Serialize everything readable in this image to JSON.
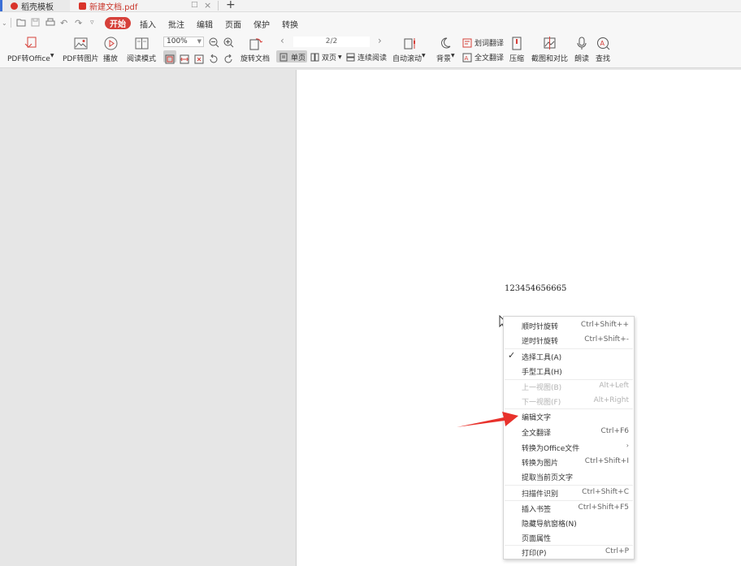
{
  "tabs": [
    {
      "label": "稻壳模板"
    },
    {
      "label": "新建文档.pdf"
    }
  ],
  "menu": {
    "active": "开始",
    "items": [
      "插入",
      "批注",
      "编辑",
      "页面",
      "保护",
      "转换"
    ]
  },
  "ribbon": {
    "pdf_to_office": "PDF转Office",
    "pdf_to_image": "PDF转图片",
    "play": "播放",
    "read_mode": "阅读模式",
    "zoom_value": "100%",
    "rotate_doc": "旋转文档",
    "page_value": "2/2",
    "single_page": "单页",
    "double_page": "双页",
    "continuous": "连续阅读",
    "auto_scroll": "自动滚动",
    "background": "背景",
    "word_translate": "划词翻译",
    "full_translate": "全文翻译",
    "compress": "压缩",
    "screenshot_compare": "截图和对比",
    "read_aloud": "朗读",
    "find": "查找"
  },
  "document": {
    "text": "123454656665"
  },
  "context_menu": {
    "items": [
      {
        "label": "顺时针旋转",
        "shortcut": "Ctrl+Shift++"
      },
      {
        "label": "逆时针旋转",
        "shortcut": "Ctrl+Shift+-"
      },
      {
        "label": "选择工具(A)",
        "shortcut": ""
      },
      {
        "label": "手型工具(H)",
        "shortcut": ""
      },
      {
        "label": "上一视图(B)",
        "shortcut": "Alt+Left"
      },
      {
        "label": "下一视图(F)",
        "shortcut": "Alt+Right"
      },
      {
        "label": "编辑文字",
        "shortcut": ""
      },
      {
        "label": "全文翻译",
        "shortcut": "Ctrl+F6"
      },
      {
        "label": "转换为Office文件",
        "shortcut": ""
      },
      {
        "label": "转换为图片",
        "shortcut": "Ctrl+Shift+I"
      },
      {
        "label": "提取当前页文字",
        "shortcut": ""
      },
      {
        "label": "扫描件识别",
        "shortcut": "Ctrl+Shift+C"
      },
      {
        "label": "插入书签",
        "shortcut": "Ctrl+Shift+F5"
      },
      {
        "label": "隐藏导航窗格(N)",
        "shortcut": ""
      },
      {
        "label": "页面属性",
        "shortcut": ""
      },
      {
        "label": "打印(P)",
        "shortcut": "Ctrl+P"
      }
    ]
  },
  "colors": {
    "accent_red": "#d6403a",
    "annotation_arrow": "#e8322c"
  }
}
